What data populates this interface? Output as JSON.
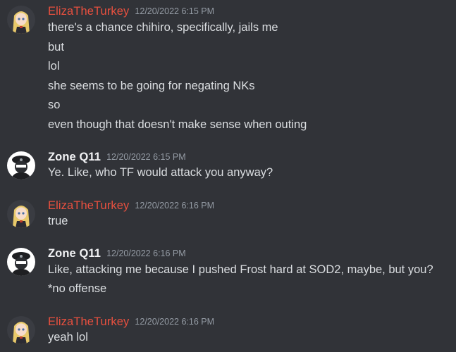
{
  "colors": {
    "background": "#313338",
    "eliza_name": "#e8503f",
    "zone_name": "#f2f3f5",
    "timestamp": "#949ba4",
    "text": "#dbdee1"
  },
  "messages": [
    {
      "author": "ElizaTheTurkey",
      "timestamp": "12/20/2022 6:15 PM",
      "avatar": "anime-girl-avatar",
      "lines": [
        "there's a chance chihiro, specifically, jails me",
        "but",
        "lol",
        "she seems to be going for negating NKs",
        "so",
        "even though that doesn't make sense when outing"
      ]
    },
    {
      "author": "Zone Q11",
      "timestamp": "12/20/2022 6:15 PM",
      "avatar": "masked-figure-avatar",
      "lines": [
        "Ye. Like, who TF would attack you anyway?"
      ]
    },
    {
      "author": "ElizaTheTurkey",
      "timestamp": "12/20/2022 6:16 PM",
      "avatar": "anime-girl-avatar",
      "lines": [
        "true"
      ]
    },
    {
      "author": "Zone Q11",
      "timestamp": "12/20/2022 6:16 PM",
      "avatar": "masked-figure-avatar",
      "lines": [
        "Like, attacking me because I pushed Frost hard at SOD2, maybe, but you?",
        "*no offense"
      ]
    },
    {
      "author": "ElizaTheTurkey",
      "timestamp": "12/20/2022 6:16 PM",
      "avatar": "anime-girl-avatar",
      "lines": [
        "yeah lol"
      ]
    }
  ]
}
